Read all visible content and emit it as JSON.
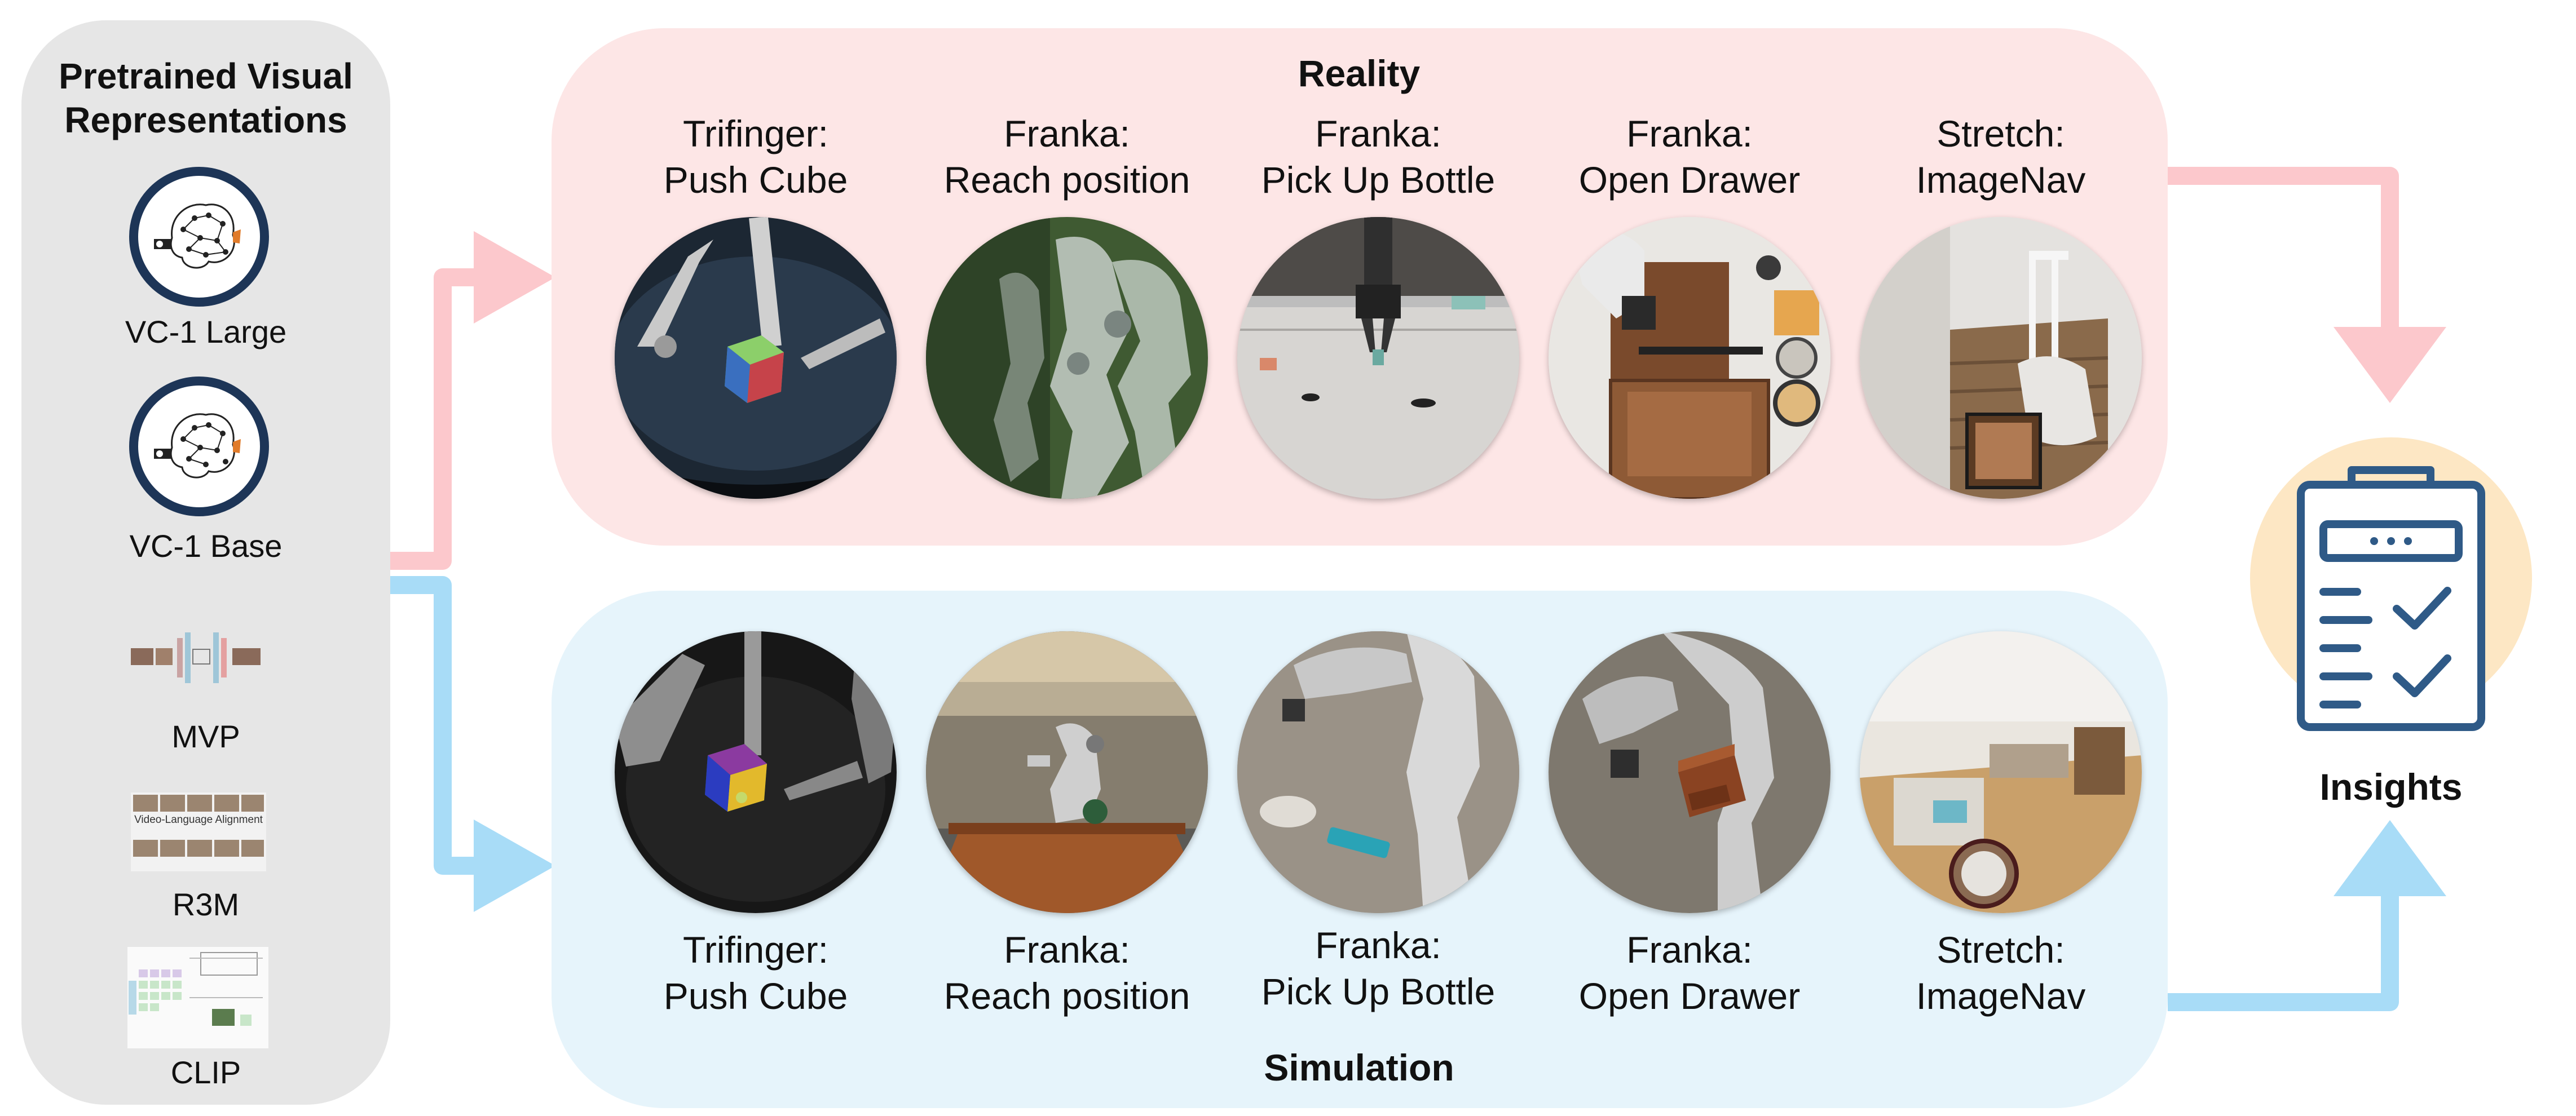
{
  "left_panel": {
    "title_line1": "Pretrained Visual",
    "title_line2": "Representations",
    "models": [
      "VC-1 Large",
      "VC-1 Base",
      "MVP",
      "R3M",
      "CLIP"
    ],
    "r3m_thumb_text": "Video-Language Alignment"
  },
  "reality": {
    "title": "Reality",
    "tasks": [
      {
        "line1": "Trifinger:",
        "line2": "Push Cube"
      },
      {
        "line1": "Franka:",
        "line2": "Reach position"
      },
      {
        "line1": "Franka:",
        "line2": "Pick Up Bottle"
      },
      {
        "line1": "Franka:",
        "line2": "Open Drawer"
      },
      {
        "line1": "Stretch:",
        "line2": "ImageNav"
      }
    ]
  },
  "simulation": {
    "title": "Simulation",
    "tasks": [
      {
        "line1": "Trifinger:",
        "line2": "Push Cube"
      },
      {
        "line1": "Franka:",
        "line2": "Reach position"
      },
      {
        "line1": "Franka:",
        "line2": "Pick Up Bottle"
      },
      {
        "line1": "Franka:",
        "line2": "Open Drawer"
      },
      {
        "line1": "Stretch:",
        "line2": "ImageNav"
      }
    ]
  },
  "insights": {
    "title": "Insights",
    "icon": "clipboard-checklist-icon"
  },
  "colors": {
    "reality_arrow": "#fcc8cc",
    "simulation_arrow": "#a8dcf7",
    "ring": "#1d3557",
    "insights_circle": "#fde7c4"
  }
}
